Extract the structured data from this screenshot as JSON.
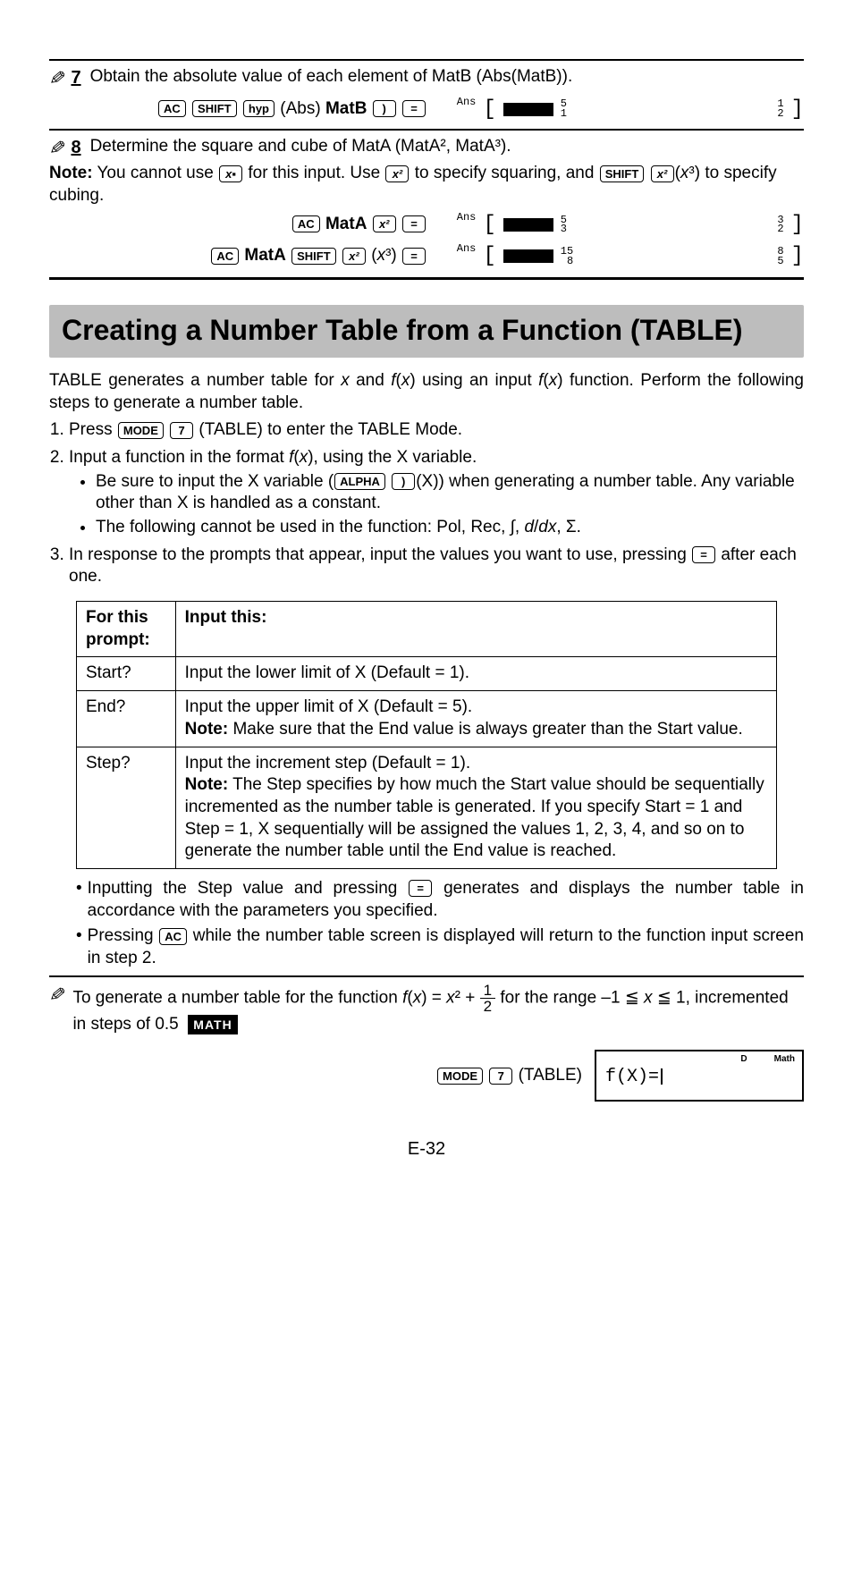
{
  "example7": {
    "number": "7",
    "text": "Obtain the absolute value of each element of MatB (Abs(MatB)).",
    "keyseq_ac": "AC",
    "keyseq_shift": "SHIFT",
    "keyseq_hyp": "hyp",
    "keyseq_abs": "(Abs)",
    "keyseq_matb": "MatB",
    "keyseq_paren": ")",
    "keyseq_eq": "=",
    "lcd_ans": "Ans",
    "lcd_frac_top1": "5",
    "lcd_frac_bot1": "1",
    "lcd_frac_top2": "1",
    "lcd_frac_bot2": "2"
  },
  "example8": {
    "number": "8",
    "intro": "Determine the square and cube of MatA (MatA², MatA³).",
    "note_label": "Note:",
    "note_text1": " You cannot use ",
    "note_key_xpow": "x▪",
    "note_text2": " for this input. Use ",
    "note_key_x2": "x²",
    "note_text3": " to specify squaring, and ",
    "note_key_shift": "SHIFT",
    "note_key_x2b": "x²",
    "note_text4": "(x³) to specify cubing.",
    "line1_ac": "AC",
    "line1_mata": "MatA",
    "line1_x2": "x²",
    "line1_eq": "=",
    "lcd1_ans": "Ans",
    "lcd1_f1t": "5",
    "lcd1_f1b": "3",
    "lcd1_f2t": "3",
    "lcd1_f2b": "2",
    "line2_ac": "AC",
    "line2_mata": "MatA",
    "line2_shift": "SHIFT",
    "line2_x2": "x²",
    "line2_x3": "(x³)",
    "line2_eq": "=",
    "lcd2_ans": "Ans",
    "lcd2_f1t": "15",
    "lcd2_f1b": "8",
    "lcd2_f2t": "8",
    "lcd2_f2b": "5"
  },
  "section": {
    "title": "Creating a Number Table from a Function (TABLE)"
  },
  "intro": {
    "p1a": "TABLE generates a number table for ",
    "p1_x": "x",
    "p1b": " and ",
    "p1_fx": "f",
    "p1_fx2": "x",
    "p1c": ") using an input ",
    "p1_fx3": "f",
    "p1_fx4": "x",
    "p1d": ") function. Perform the following steps to generate a number table."
  },
  "steps": {
    "s1a": "Press ",
    "s1_mode": "MODE",
    "s1_7": "7",
    "s1b": " (TABLE) to enter the TABLE Mode.",
    "s2a": "Input a function in the format ",
    "s2_f": "f",
    "s2_x": "x",
    "s2b": "), using the X variable.",
    "s2_bul1a": "Be sure to input the X variable (",
    "s2_alpha": "ALPHA",
    "s2_paren": ")",
    "s2_bul1b": "(X)) when generating a number table. Any variable other than X is handled as a constant.",
    "s2_bul2": "The following cannot be used in the function: Pol, Rec, ∫, d/dx, Σ.",
    "s3a": "In response to the prompts that appear, input the values you want to use, pressing ",
    "s3_eq": "=",
    "s3b": " after each one."
  },
  "table": {
    "h1": "For this prompt:",
    "h2": "Input this:",
    "r1p": "Start?",
    "r1v": "Input the lower limit of X (Default = 1).",
    "r2p": "End?",
    "r2v": "Input the upper limit of X (Default = 5).",
    "r2note_label": "Note:",
    "r2note": " Make sure that the End value is always greater than the Start value.",
    "r3p": "Step?",
    "r3v": "Input the increment step (Default = 1).",
    "r3note_label": "Note:",
    "r3note": " The Step specifies by how much the Start value should be sequentially incremented as the number table is generated. If you specify Start = 1 and Step = 1, X sequentially will be assigned the values 1, 2, 3, 4, and so on to generate the number table until the End value is reached."
  },
  "notes": {
    "n1a": "Inputting the Step value and pressing ",
    "n1_eq": "=",
    "n1b": " generates and displays the number table in accordance with the parameters you specified.",
    "n2a": "Pressing ",
    "n2_ac": "AC",
    "n2b": " while the number table screen is displayed will return to the function input screen in step 2."
  },
  "example_table": {
    "t1": "To generate a number table for the function  ",
    "t_f": "f",
    "t_x": "x",
    "t2": ") = ",
    "t_x2": "x",
    "t3": "² + ",
    "frac_num": "1",
    "frac_den": "2",
    "t4": "  for the range –1 ≦ ",
    "t_xr": "x",
    "t5": " ≦ 1, incremented in steps of 0.5",
    "math_badge": "MATH",
    "key_mode": "MODE",
    "key_7": "7",
    "key_table": "(TABLE)",
    "lcd_d": "D",
    "lcd_math": "Math",
    "lcd_fx": "f(X)="
  },
  "pagenum": "E-32"
}
